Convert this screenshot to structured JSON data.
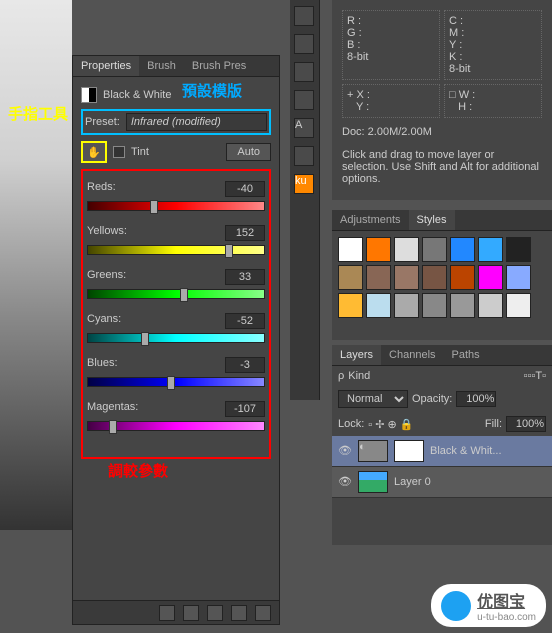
{
  "properties": {
    "tabs": [
      "Properties",
      "Brush",
      "Brush Pres"
    ],
    "title": "Black & White",
    "preset_label": "Preset:",
    "preset_value": "Infrared (modified)",
    "tint_label": "Tint",
    "auto_label": "Auto",
    "sliders": [
      {
        "label": "Reds:",
        "value": "-40",
        "pos": 35
      },
      {
        "label": "Yellows:",
        "value": "152",
        "pos": 78
      },
      {
        "label": "Greens:",
        "value": "33",
        "pos": 52
      },
      {
        "label": "Cyans:",
        "value": "-52",
        "pos": 30
      },
      {
        "label": "Blues:",
        "value": "-3",
        "pos": 45
      },
      {
        "label": "Magentas:",
        "value": "-107",
        "pos": 12
      }
    ]
  },
  "annotations": {
    "blue": "預設模版",
    "yellow": "手指工具",
    "red": "調較參數"
  },
  "info": {
    "rgb": {
      "R": "",
      "G": "",
      "B": ""
    },
    "cmyk": {
      "C": "",
      "M": "",
      "Y": "",
      "K": ""
    },
    "bit1": "8-bit",
    "bit2": "8-bit",
    "xy": {
      "X": "",
      "Y": ""
    },
    "wh": {
      "W": "",
      "H": ""
    },
    "doc": "Doc: 2.00M/2.00M",
    "hint": "Click and drag to move layer or selection. Use Shift and Alt for additional options."
  },
  "styles": {
    "tabs": [
      "Adjustments",
      "Styles"
    ],
    "colors": [
      "#fff",
      "#f70",
      "#ddd",
      "#777",
      "#28f",
      "#3af",
      "#222",
      "#a85",
      "#865",
      "#976",
      "#754",
      "#b40",
      "#f0f",
      "#8af",
      "#fb3",
      "#bde",
      "#aaa",
      "#888",
      "#999",
      "#ccc",
      "#eee"
    ]
  },
  "layers": {
    "tabs": [
      "Layers",
      "Channels",
      "Paths"
    ],
    "kind": "Kind",
    "blend": "Normal",
    "opacity_label": "Opacity:",
    "opacity": "100%",
    "lock_label": "Lock:",
    "fill_label": "Fill:",
    "fill": "100%",
    "items": [
      {
        "name": "Black & Whit...",
        "type": "adj"
      },
      {
        "name": "Layer 0",
        "type": "img"
      }
    ]
  },
  "logo": {
    "text": "优图宝",
    "url": "u-tu-bao.com"
  }
}
